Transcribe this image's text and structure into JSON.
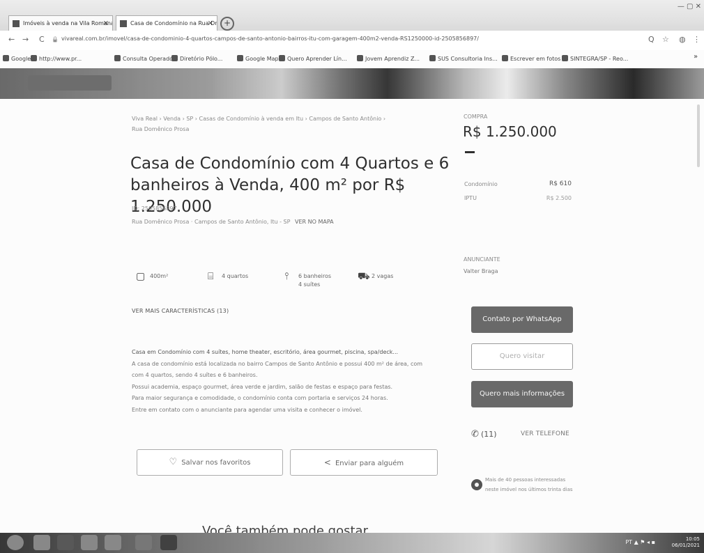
{
  "browser": {
    "tabs": [
      {
        "label": "Imóveis à venda na Vila Romana",
        "close": "×"
      },
      {
        "label": "Casa de Condomínio na Rua Dr...",
        "close": "×"
      }
    ],
    "new_tab": "+",
    "url": "vivareal.com.br/imovel/casa-de-condominio-4-quartos-campos-de-santo-antonio-bairros-itu-com-garagem-400m2-venda-RS1250000-id-2505856897/",
    "nav": {
      "back": "←",
      "forward": "→",
      "reload": "C",
      "lock": "🔒"
    },
    "right_icons": {
      "search": "Q",
      "star": "☆",
      "profile": "◍",
      "menu": "⋮"
    },
    "bookmarks": [
      {
        "label": "Google"
      },
      {
        "label": "http://www.pr..."
      },
      {
        "label": "Consulta Operador"
      },
      {
        "label": "Diretório Pólo..."
      },
      {
        "label": "Google Maps"
      },
      {
        "label": "Quero Aprender Lín..."
      },
      {
        "label": "Jovem Aprendiz Z..."
      },
      {
        "label": "SUS Consultoria Ins..."
      },
      {
        "label": "Escrever em fotos"
      },
      {
        "label": "SINTEGRA/SP - Reo..."
      }
    ],
    "bookmarks_more": "»"
  },
  "listing": {
    "breadcrumb_line1": "Viva Real › Venda › SP › Casas de Condomínio à venda em Itu › Campos de Santo Antônio ›",
    "breadcrumb_line2": "Rua Domênico Prosa",
    "title": "Casa de Condomínio com 4 Quartos e 6 banheiros à Venda, 400 m² por R$ 1.250.000",
    "code": "ID: 2505856897",
    "address": "Rua Domênico Prosa · Campos de Santo Antônio, Itu - SP",
    "map_link": "VER NO MAPA",
    "features": {
      "area": "400m²",
      "bedrooms": "4 quartos",
      "bathrooms_line1": "6 banheiros",
      "bathrooms_line2": "4 suítes",
      "parking": "2 vagas"
    },
    "more_features": "VER MAIS CARACTERÍSTICAS (13)",
    "description": [
      "Casa em Condomínio com 4 suítes, home theater, escritório, área gourmet, piscina, spa/deck...",
      "A casa de condomínio está localizada no bairro Campos de Santo Antônio e possui 400 m² de área, com",
      "com 4 quartos, sendo 4 suítes e 6 banheiros.",
      "Possui academia, espaço gourmet, área verde e jardim, salão de festas e espaço para festas.",
      "Para maior segurança e comodidade, o condomínio conta com portaria e serviços 24 horas.",
      "Entre em contato com o anunciante para agendar uma visita e conhecer o imóvel."
    ],
    "favorite_label": "Salvar nos favoritos",
    "share_label": "Enviar para alguém",
    "maybe_like": "Você também pode gostar"
  },
  "sidebar": {
    "price_label": "COMPRA",
    "price": "R$ 1.250.000",
    "condo_label": "Condomínio",
    "condo_value": "R$ 610",
    "iptu_label": "IPTU",
    "iptu_value": "R$ 2.500",
    "advertiser_label": "ANUNCIANTE",
    "advertiser_name": "Valter Braga",
    "whatsapp_button": "Contato por WhatsApp",
    "visit_button": "Quero visitar",
    "info_button": "Quero mais informações",
    "phone": "(11)",
    "show_phone": "VER TELEFONE",
    "interest_text": "Mais de 40 pessoas interessadas neste imóvel nos últimos trinta dias"
  },
  "taskbar": {
    "clock_time": "10:05",
    "clock_date": "06/01/2021",
    "tray": "PT ▲ ⚑ ◂ ▪"
  }
}
